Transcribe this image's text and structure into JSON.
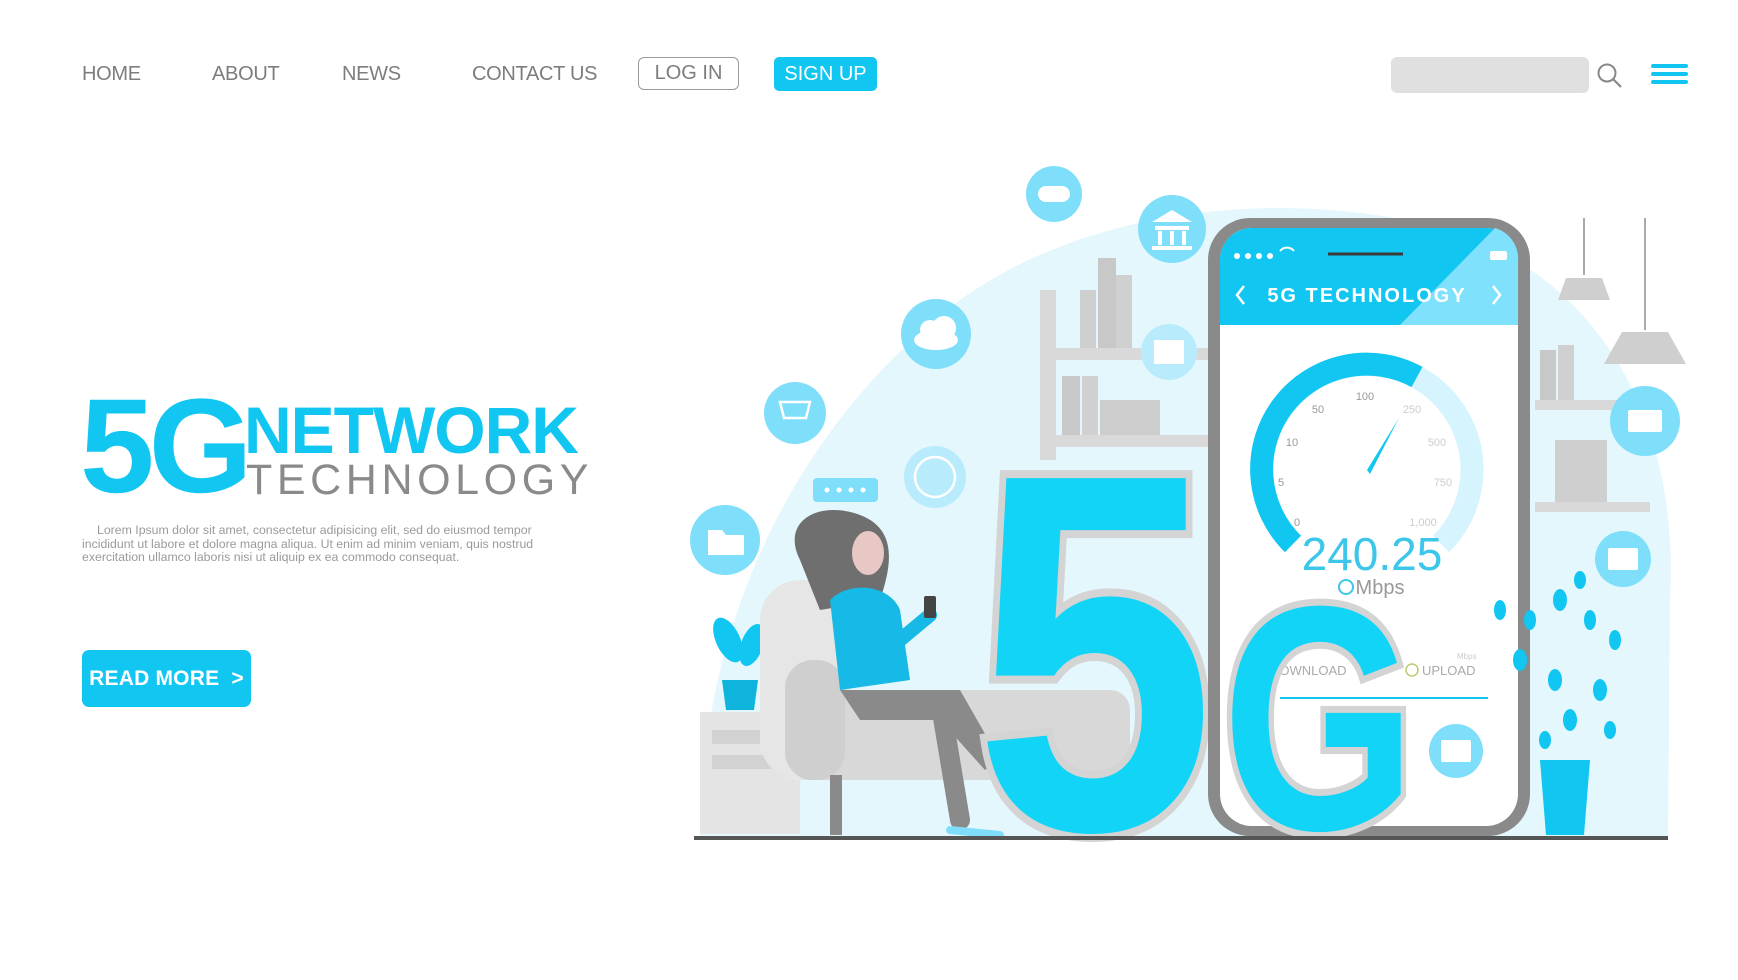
{
  "nav": {
    "items": [
      {
        "label": "HOME"
      },
      {
        "label": "ABOUT"
      },
      {
        "label": "NEWS"
      },
      {
        "label": "CONTACT US"
      }
    ],
    "login_label": "LOG IN",
    "signup_label": "SIGN UP",
    "search_placeholder": "",
    "search_icon": "search-icon",
    "menu_icon": "hamburger-menu-icon"
  },
  "hero": {
    "title_big": "5G",
    "title_top": "NETWORK",
    "title_bottom": "TECHNOLOGY",
    "body": "Lorem Ipsum dolor sit amet, consectetur adipisicing elit, sed do eiusmod tempor incididunt ut labore et dolore magna aliqua. Ut enim ad minim veniam, quis nostrud exercitation ullamco laboris nisi ut aliquip ex ea commodo consequat.",
    "cta_label": "READ MORE  >"
  },
  "illustration": {
    "big_text_5": "5",
    "big_text_g": "G",
    "phone": {
      "title": "5G TECHNOLOGY",
      "gauge_ticks": [
        "0",
        "5",
        "10",
        "50",
        "100",
        "250",
        "500",
        "750",
        "1,000"
      ],
      "speed_value": "240.25",
      "speed_unit": "Mbps",
      "download_label": "DOWNLOAD",
      "upload_label": "UPLOAD",
      "small_unit": "Mbps"
    },
    "floating_icons": [
      "gamepad-icon",
      "bank-icon",
      "cloud-icon",
      "image-icon",
      "cart-icon",
      "globe-icon",
      "chat-bubble-icon",
      "folder-icon",
      "video-icon",
      "mail-icon",
      "list-icon"
    ],
    "colors": {
      "accent": "#12c6f2",
      "light": "#e3f7fd",
      "icon_circle": "#7fdffa",
      "gray": "#d6d6d6"
    }
  }
}
